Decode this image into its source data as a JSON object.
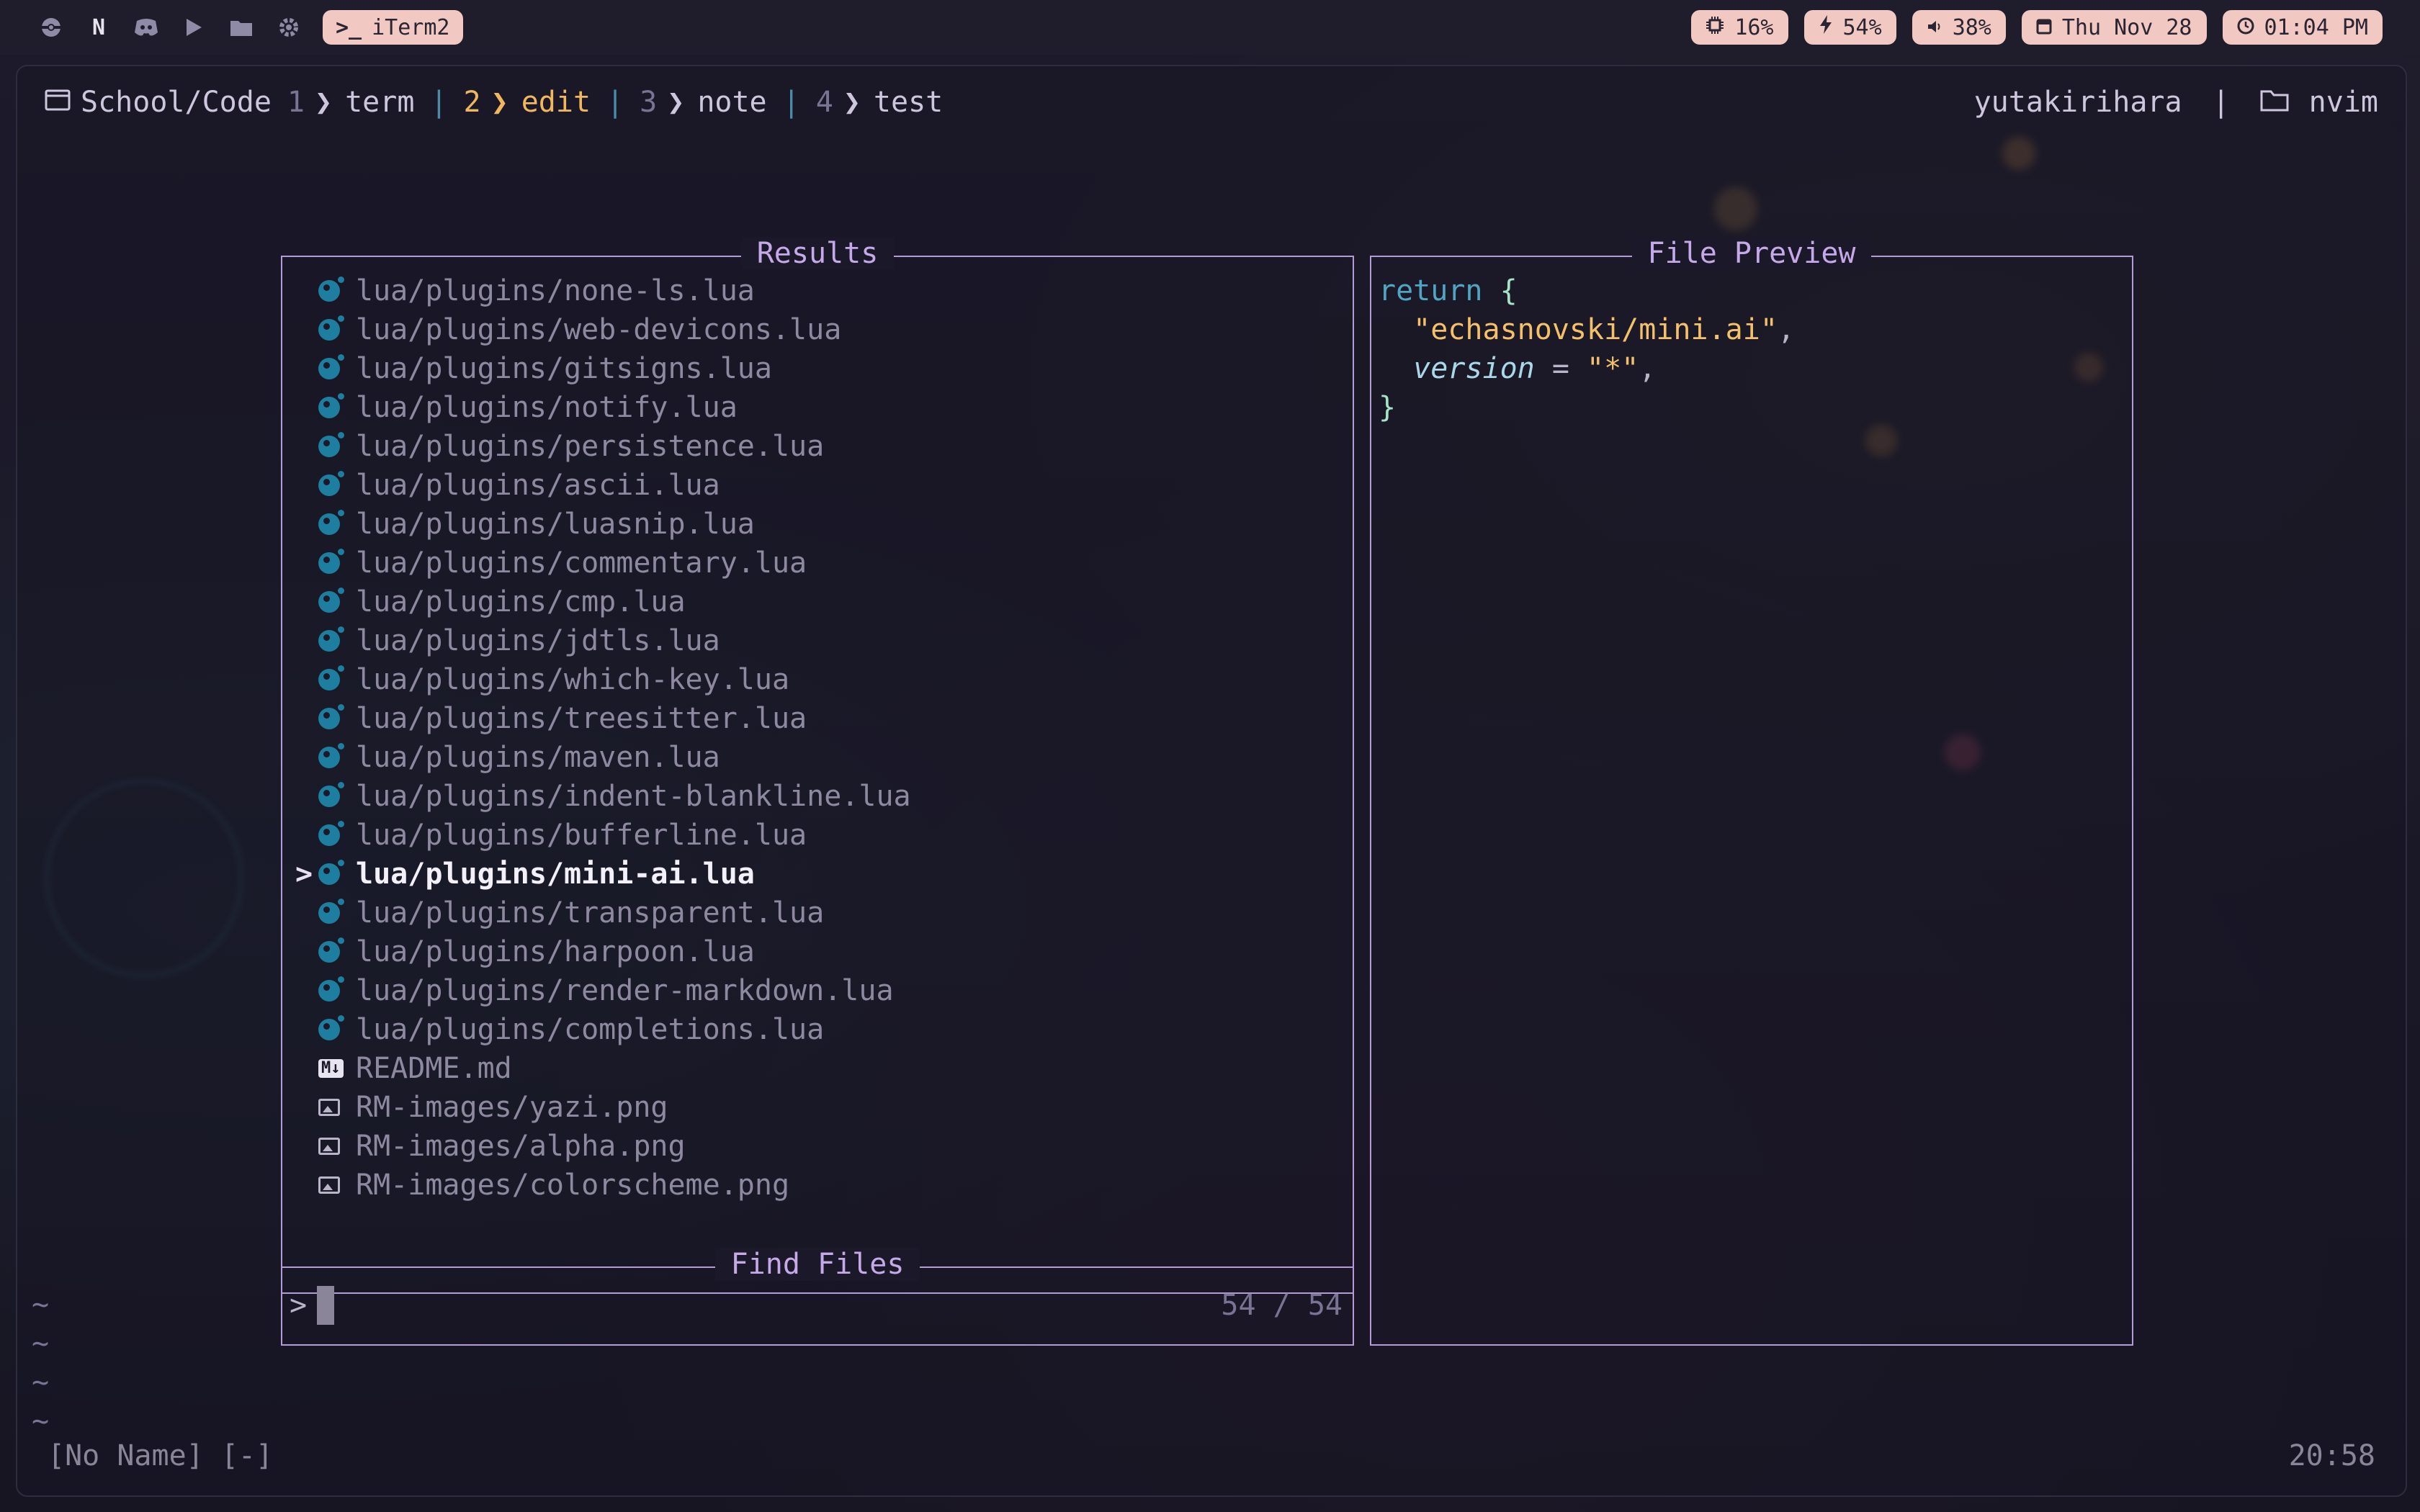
{
  "menubar": {
    "app_name": "iTerm2",
    "left_icons": [
      "pokeball-icon",
      "notion-icon",
      "discord-icon",
      "play-icon",
      "folder-icon",
      "gear-icon"
    ],
    "status": {
      "cpu": "16%",
      "battery": "54%",
      "volume": "38%",
      "date": "Thu Nov 28",
      "time": "01:04 PM"
    }
  },
  "tmux": {
    "session": "School/Code",
    "windows": [
      {
        "index": "1",
        "name": "term",
        "active": false
      },
      {
        "index": "2",
        "name": "edit",
        "active": true
      },
      {
        "index": "3",
        "name": "note",
        "active": false
      },
      {
        "index": "4",
        "name": "test",
        "active": false
      }
    ],
    "user": "yutakirihara",
    "separator": "|",
    "program": "nvim"
  },
  "results": {
    "title": "Results",
    "selected_caret": ">",
    "items": [
      {
        "path": "lua/plugins/none-ls.lua",
        "icon": "lua-icon"
      },
      {
        "path": "lua/plugins/web-devicons.lua",
        "icon": "lua-icon"
      },
      {
        "path": "lua/plugins/gitsigns.lua",
        "icon": "lua-icon"
      },
      {
        "path": "lua/plugins/notify.lua",
        "icon": "lua-icon"
      },
      {
        "path": "lua/plugins/persistence.lua",
        "icon": "lua-icon"
      },
      {
        "path": "lua/plugins/ascii.lua",
        "icon": "lua-icon"
      },
      {
        "path": "lua/plugins/luasnip.lua",
        "icon": "lua-icon"
      },
      {
        "path": "lua/plugins/commentary.lua",
        "icon": "lua-icon"
      },
      {
        "path": "lua/plugins/cmp.lua",
        "icon": "lua-icon"
      },
      {
        "path": "lua/plugins/jdtls.lua",
        "icon": "lua-icon"
      },
      {
        "path": "lua/plugins/which-key.lua",
        "icon": "lua-icon"
      },
      {
        "path": "lua/plugins/treesitter.lua",
        "icon": "lua-icon"
      },
      {
        "path": "lua/plugins/maven.lua",
        "icon": "lua-icon"
      },
      {
        "path": "lua/plugins/indent-blankline.lua",
        "icon": "lua-icon"
      },
      {
        "path": "lua/plugins/bufferline.lua",
        "icon": "lua-icon"
      },
      {
        "path": "lua/plugins/mini-ai.lua",
        "icon": "lua-icon",
        "selected": true
      },
      {
        "path": "lua/plugins/transparent.lua",
        "icon": "lua-icon"
      },
      {
        "path": "lua/plugins/harpoon.lua",
        "icon": "lua-icon"
      },
      {
        "path": "lua/plugins/render-markdown.lua",
        "icon": "lua-icon"
      },
      {
        "path": "lua/plugins/completions.lua",
        "icon": "lua-icon"
      },
      {
        "path": "README.md",
        "icon": "markdown-icon"
      },
      {
        "path": "RM-images/yazi.png",
        "icon": "image-icon"
      },
      {
        "path": "RM-images/alpha.png",
        "icon": "image-icon"
      },
      {
        "path": "RM-images/colorscheme.png",
        "icon": "image-icon"
      }
    ]
  },
  "preview": {
    "title": "File Preview",
    "code": {
      "keyword": "return",
      "open_brace": "{",
      "string1": "\"echasnovski/mini.ai\"",
      "key": "version",
      "equals": "=",
      "string2": "\"*\"",
      "comma": ",",
      "close_brace": "}"
    }
  },
  "finder": {
    "title": "Find Files",
    "prompt": ">",
    "query": "",
    "counter": "54 / 54"
  },
  "buffer": {
    "tilde": "~",
    "status_left": "[No Name] [-]",
    "status_right": "20:58"
  },
  "colors": {
    "border": "#b59ad8",
    "accent_orange": "#f0b85e",
    "lua_blue": "#1d7ea0",
    "pill_bg": "#f2c9c2"
  }
}
